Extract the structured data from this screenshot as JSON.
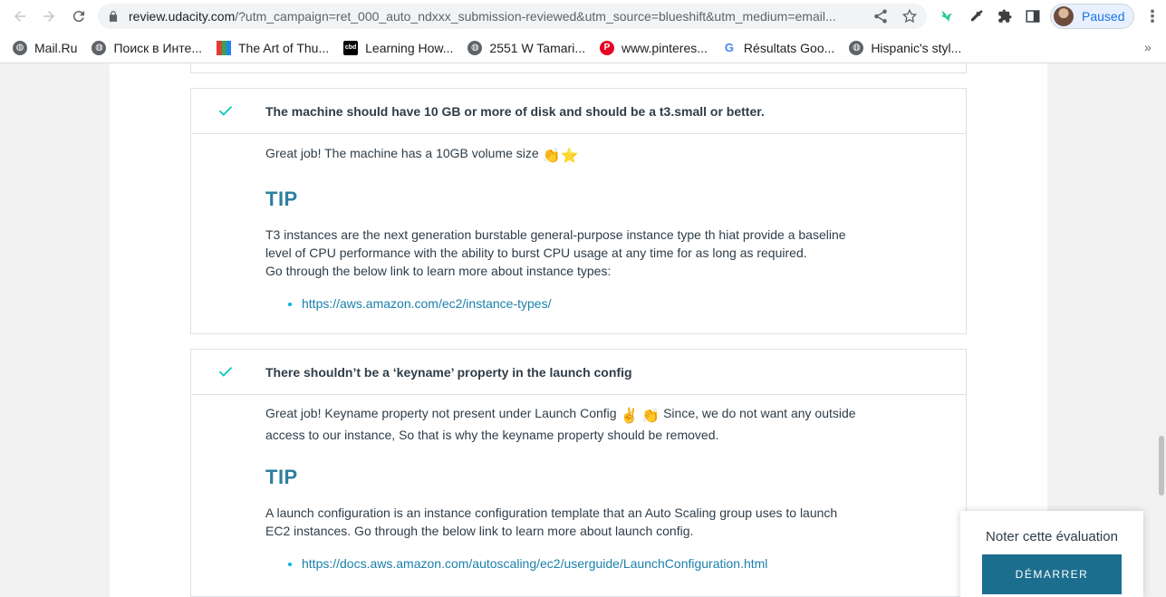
{
  "browser": {
    "url_host": "review.udacity.com",
    "url_rest": "/?utm_campaign=ret_000_auto_ndxxx_submission-reviewed&utm_source=blueshift&utm_medium=email...",
    "profile_label": "Paused",
    "bookmarks": [
      {
        "label": "Mail.Ru",
        "icon": "globe-icon",
        "color": "#5f6368"
      },
      {
        "label": "Поиск в Инте...",
        "icon": "globe-icon",
        "color": "#5f6368"
      },
      {
        "label": "The Art of Thu...",
        "icon": "grid-icon",
        "color": "#e53935"
      },
      {
        "label": "Learning How...",
        "icon": "cbd-icon",
        "color": "#000000"
      },
      {
        "label": "2551 W Tamari...",
        "icon": "globe-icon",
        "color": "#5f6368"
      },
      {
        "label": "www.pinteres...",
        "icon": "pinterest-icon",
        "color": "#e60023"
      },
      {
        "label": "Résultats Goo...",
        "icon": "google-icon",
        "color": "#4285f4"
      },
      {
        "label": "Hispanic's styl...",
        "icon": "globe-icon",
        "color": "#5f6368"
      }
    ],
    "bookmarks_more": "»"
  },
  "review": {
    "items": [
      {
        "heading": "The machine should have 10 GB or more of disk and should be a t3.small or better.",
        "comment": "Great job! The machine has a 10GB volume size",
        "comment_cont": "",
        "tip_label": "TIP",
        "tip_lines": [
          "T3 instances are the next generation burstable general-purpose instance type th hiat provide a baseline",
          "level of CPU performance with the ability to burst CPU usage at any time for as long as required.",
          "Go through the below link to learn more about instance types:"
        ],
        "link": "https://aws.amazon.com/ec2/instance-types/"
      },
      {
        "heading": "There shouldn’t be a ‘keyname’ property in the launch config",
        "comment": "Great job! Keyname property not present under Launch Config",
        "comment_cont": "Since, we do not want any outside",
        "comment_line2": "access to our instance, So that is why the keyname property should be removed.",
        "tip_label": "TIP",
        "tip_lines": [
          "A launch configuration is an instance configuration template that an Auto Scaling group uses to launch",
          "EC2 instances. Go through the below link to learn more about launch config."
        ],
        "link": "https://docs.aws.amazon.com/autoscaling/ec2/userguide/LaunchConfiguration.html"
      }
    ]
  },
  "rating": {
    "title": "Noter cette évaluation",
    "button": "DÉMARRER"
  },
  "colors": {
    "check": "#02ccba",
    "tip": "#2d7fa1",
    "link": "#1b80ab",
    "button": "#1c6e8f"
  }
}
